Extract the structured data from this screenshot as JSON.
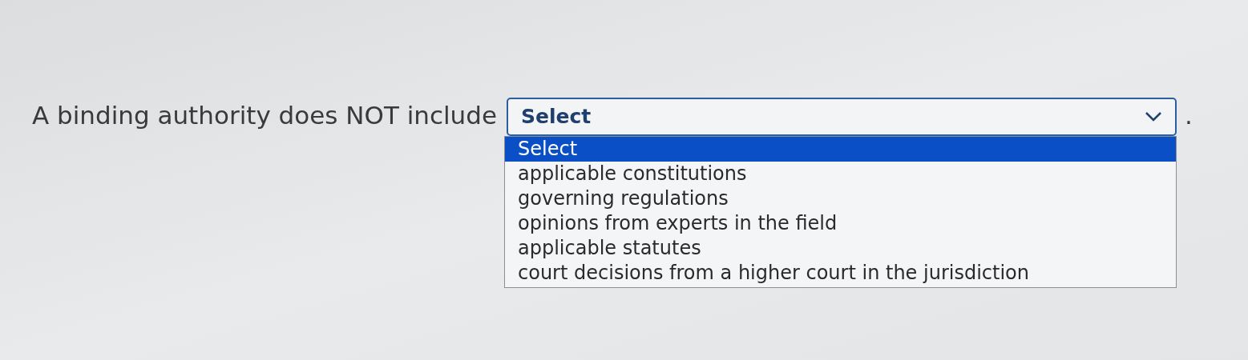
{
  "question": {
    "prompt": "A binding authority does NOT include",
    "select": {
      "value": "Select",
      "expanded": true,
      "options": [
        {
          "label": "Select",
          "selected": true
        },
        {
          "label": "applicable constitutions",
          "selected": false
        },
        {
          "label": "governing regulations",
          "selected": false
        },
        {
          "label": "opinions from experts in the field",
          "selected": false
        },
        {
          "label": "applicable statutes",
          "selected": false
        },
        {
          "label": "court decisions from a higher court in the jurisdiction",
          "selected": false
        }
      ]
    },
    "suffix": "."
  }
}
